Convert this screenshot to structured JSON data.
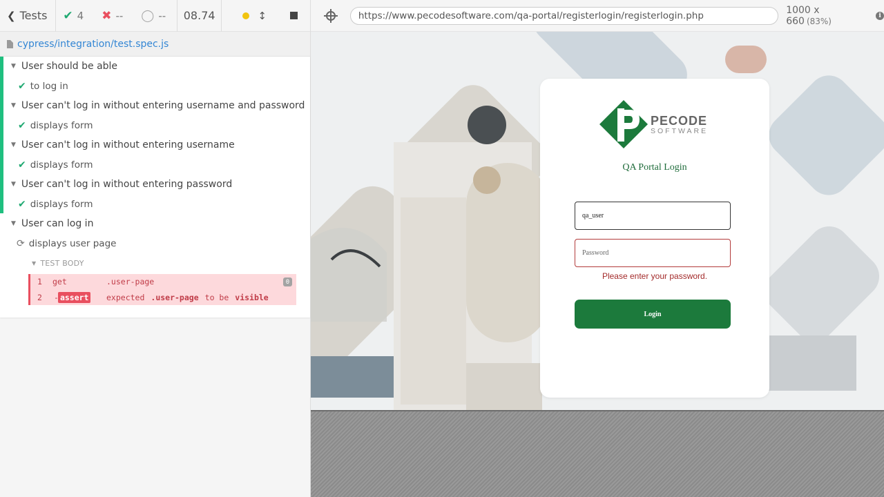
{
  "reporter": {
    "tests_label": "Tests",
    "stats": {
      "passed": "4",
      "failed": "--",
      "pending": "--"
    },
    "duration": "08.74",
    "spec_path": "cypress/integration/test.spec.js",
    "suites": [
      {
        "title": "User should be able",
        "tests": [
          "to log in"
        ]
      },
      {
        "title": "User can't log in without entering username and password",
        "tests": [
          "displays form"
        ]
      },
      {
        "title": "User can't log in without entering username",
        "tests": [
          "displays form"
        ]
      },
      {
        "title": "User can't log in without entering password",
        "tests": [
          "displays form"
        ]
      },
      {
        "title": "User can log in",
        "tests": [
          "displays user page"
        ]
      }
    ],
    "test_body_label": "TEST BODY",
    "commands": [
      {
        "num": "1",
        "name": "get",
        "message": ".user-page"
      },
      {
        "num": "2",
        "name": "assert",
        "message_parts": [
          "expected",
          ".user-page",
          "to be",
          "visible"
        ]
      }
    ],
    "command_count": "0"
  },
  "aut": {
    "url": "https://www.pecodesoftware.com/qa-portal/registerlogin/registerlogin.php",
    "viewport": "1000 x 660",
    "scale": "(83%)",
    "info_glyph": "i",
    "page": {
      "brand_name": "PECODE",
      "brand_sub": "SOFTWARE",
      "title": "QA Portal Login",
      "username_value": "qa_user",
      "password_placeholder": "Password",
      "password_error": "Please enter your password.",
      "login_label": "Login",
      "colors": {
        "brand_green": "#1c7a3c",
        "error_red": "#a32a2a"
      }
    }
  }
}
